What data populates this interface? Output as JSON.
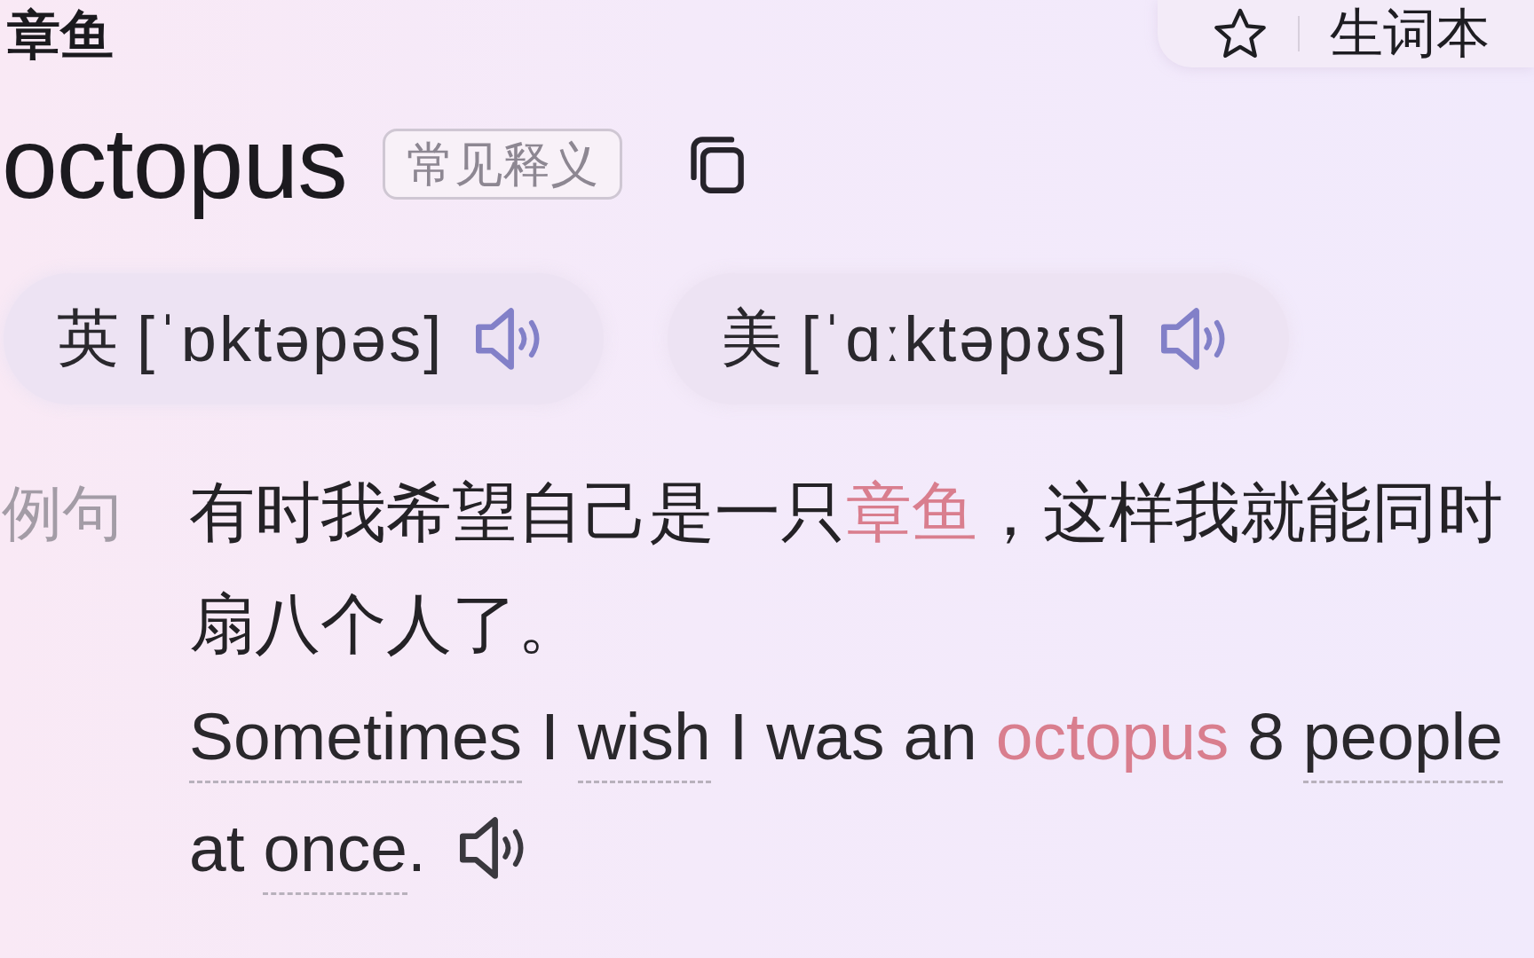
{
  "header": {
    "title": "章鱼",
    "wordbook_button": {
      "label": "生词本"
    }
  },
  "word": {
    "text": "octopus",
    "tag": "常见释义"
  },
  "pronunciations": [
    {
      "region": "英",
      "phonetic": "[ˈɒktəpəs]"
    },
    {
      "region": "美",
      "phonetic": "[ˈɑːktəpʊs]"
    }
  ],
  "example": {
    "label": "例句",
    "chinese": [
      {
        "text": "有时我希望自己是一只",
        "highlight": false
      },
      {
        "text": "章鱼",
        "highlight": true
      },
      {
        "text": "，这样我就能同时扇八个人了。",
        "highlight": false
      }
    ],
    "english_lines": [
      [
        {
          "text": "Sometimes",
          "highlight": false,
          "underlined": true
        },
        {
          "text": " I ",
          "highlight": false,
          "underlined": false
        },
        {
          "text": "wish",
          "highlight": false,
          "underlined": true
        },
        {
          "text": " I was an ",
          "highlight": false,
          "underlined": false
        },
        {
          "text": "octopus",
          "highlight": true,
          "underlined": false
        },
        {
          "text": " 8 ",
          "highlight": false,
          "underlined": false
        },
        {
          "text": "people",
          "highlight": false,
          "underlined": true
        }
      ],
      [
        {
          "text": "at ",
          "highlight": false,
          "underlined": false
        },
        {
          "text": "once",
          "highlight": false,
          "underlined": true
        },
        {
          "text": ".",
          "highlight": false,
          "underlined": false
        }
      ]
    ]
  }
}
